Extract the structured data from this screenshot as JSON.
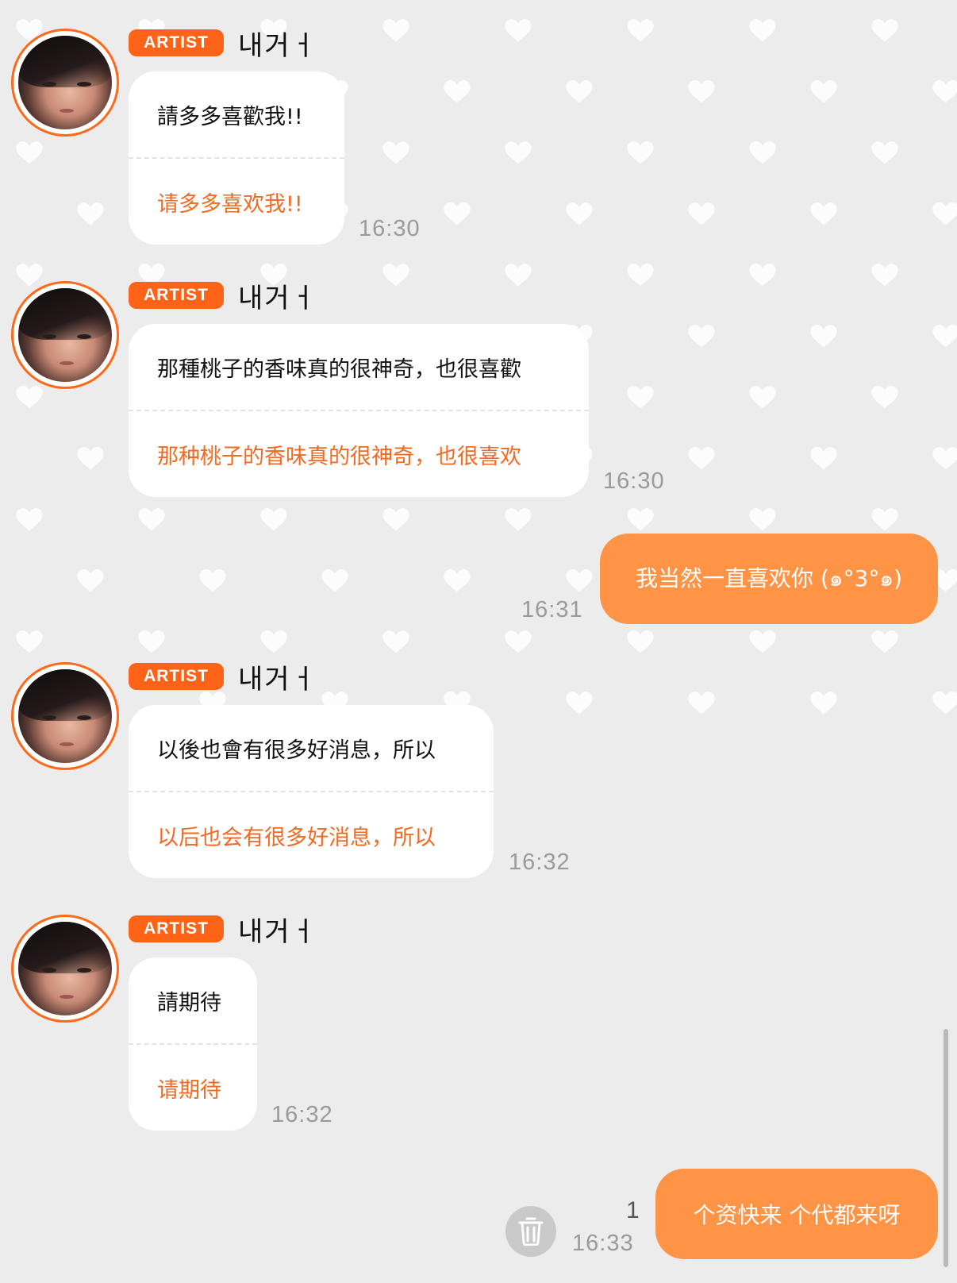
{
  "colors": {
    "background": "#ececec",
    "accent": "#ff6317",
    "outgoing_bubble": "#ff9346",
    "translation_text": "#f26a21",
    "timestamp": "#9a9a9a"
  },
  "messages": [
    {
      "badge": "ARTIST",
      "sender": "내거ㅓ",
      "original": "請多多喜歡我!!",
      "translation": "请多多喜欢我!!",
      "time": "16:30"
    },
    {
      "badge": "ARTIST",
      "sender": "내거ㅓ",
      "original": "那種桃子的香味真的很神奇，也很喜歡",
      "translation": "那种桃子的香味真的很神奇，也很喜欢",
      "time": "16:30"
    },
    {
      "outgoing": true,
      "text": "我当然一直喜欢你 (๑°3°๑)",
      "time": "16:31"
    },
    {
      "badge": "ARTIST",
      "sender": "내거ㅓ",
      "original": "以後也會有很多好消息，所以",
      "translation": "以后也会有很多好消息，所以",
      "time": "16:32"
    },
    {
      "badge": "ARTIST",
      "sender": "내거ㅓ",
      "original": "請期待",
      "translation": "请期待",
      "time": "16:32"
    },
    {
      "outgoing": true,
      "text": "个资快来 个代都来呀",
      "time": "16:33",
      "unread_count": "1"
    }
  ],
  "icons": {
    "trash": "trash-icon",
    "background_pattern": "heart-icon"
  }
}
